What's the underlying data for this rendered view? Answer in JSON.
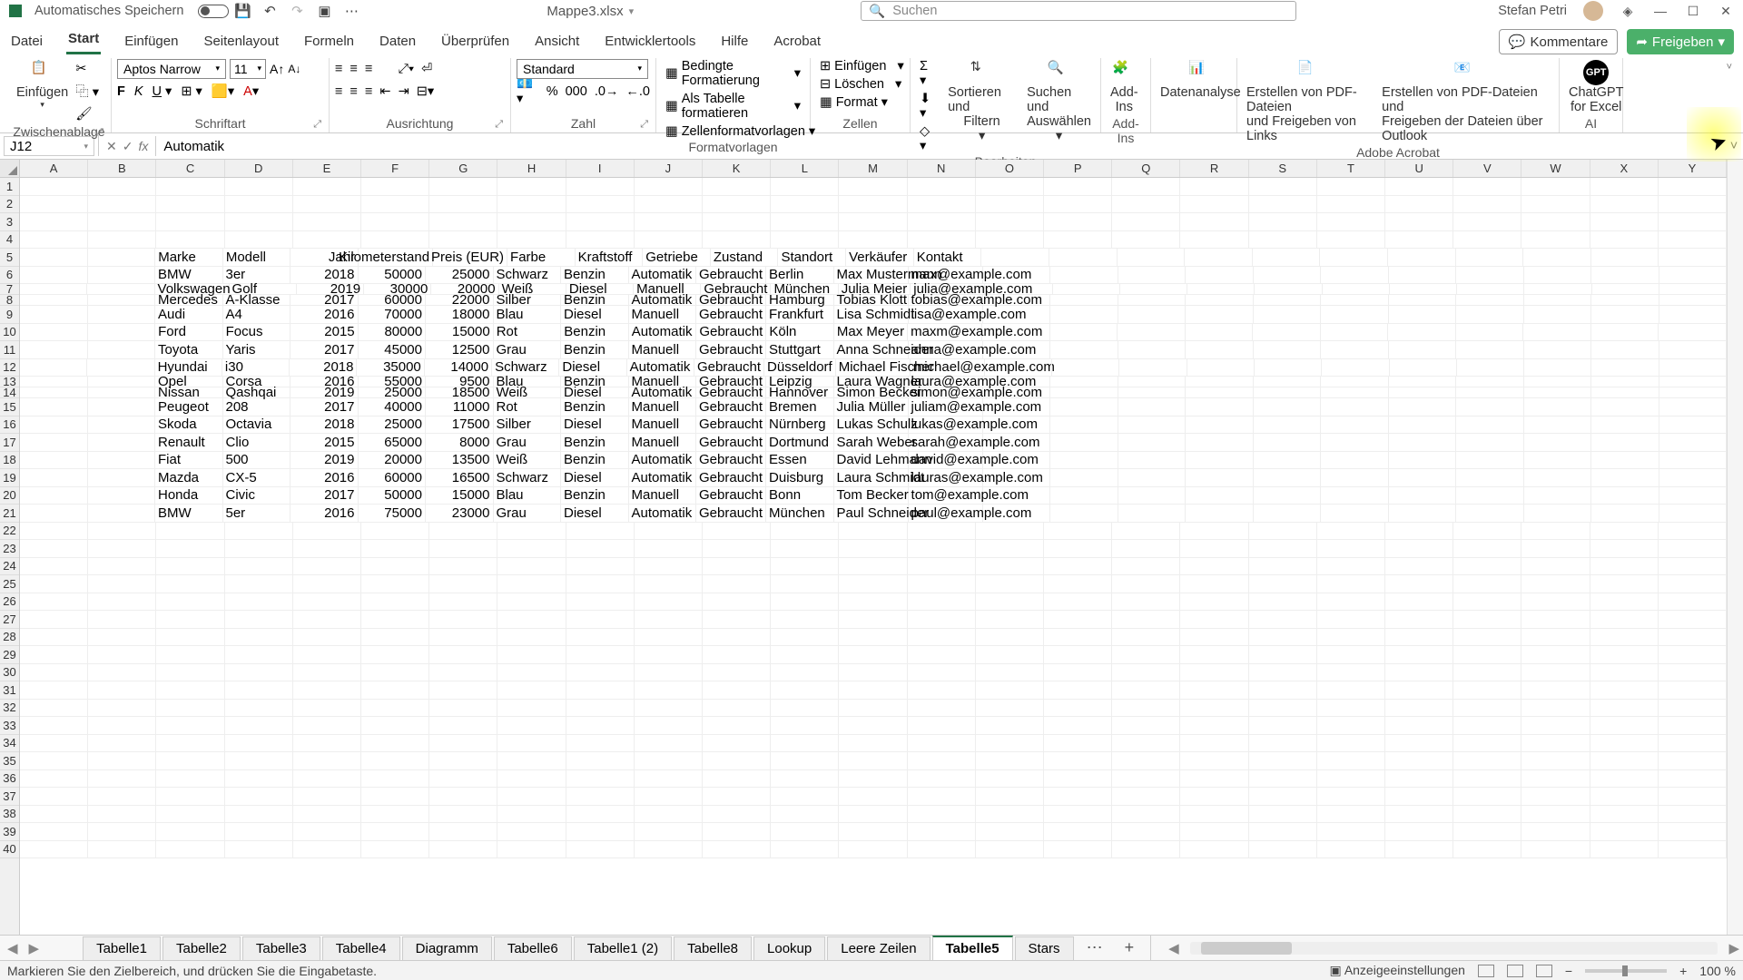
{
  "titlebar": {
    "autosave_label": "Automatisches Speichern",
    "filename": "Mappe3.xlsx",
    "search_placeholder": "Suchen",
    "username": "Stefan Petri"
  },
  "menutabs": [
    "Datei",
    "Start",
    "Einfügen",
    "Seitenlayout",
    "Formeln",
    "Daten",
    "Überprüfen",
    "Ansicht",
    "Entwicklertools",
    "Hilfe",
    "Acrobat"
  ],
  "active_tab": 1,
  "menu_right": {
    "comments": "Kommentare",
    "share": "Freigeben"
  },
  "ribbon": {
    "clipboard": {
      "label": "Zwischenablage",
      "paste": "Einfügen"
    },
    "font": {
      "label": "Schriftart",
      "name": "Aptos Narrow",
      "size": "11",
      "bold": "F",
      "italic": "K",
      "underline": "U"
    },
    "align": {
      "label": "Ausrichtung"
    },
    "number": {
      "label": "Zahl",
      "format": "Standard"
    },
    "styles": {
      "label": "Formatvorlagen",
      "cond": "Bedingte Formatierung",
      "table": "Als Tabelle formatieren",
      "cellstyles": "Zellenformatvorlagen"
    },
    "cells": {
      "label": "Zellen",
      "insert": "Einfügen",
      "delete": "Löschen",
      "format": "Format"
    },
    "editing": {
      "label": "Bearbeiten",
      "sort": "Sortieren und",
      "sort2": "Filtern",
      "find": "Suchen und",
      "find2": "Auswählen"
    },
    "addins": {
      "label": "Add-Ins",
      "addins": "Add-",
      "addins2": "Ins"
    },
    "analysis": {
      "label": "",
      "btn": "Datenanalyse"
    },
    "acrobat": {
      "label": "Adobe Acrobat",
      "pdf1a": "Erstellen von PDF-Dateien",
      "pdf1b": "und Freigeben von Links",
      "pdf2a": "Erstellen von PDF-Dateien und",
      "pdf2b": "Freigeben der Dateien über Outlook"
    },
    "ai": {
      "label": "AI",
      "gpt1": "ChatGPT",
      "gpt2": "for Excel"
    }
  },
  "formulabar": {
    "namebox": "J12",
    "formula": "Automatik"
  },
  "columns_visible": [
    "A",
    "B",
    "C",
    "D",
    "E",
    "F",
    "G",
    "H",
    "I",
    "J",
    "K",
    "L",
    "M",
    "N",
    "O",
    "P",
    "Q",
    "R",
    "S",
    "T",
    "U",
    "V",
    "W",
    "X",
    "Y"
  ],
  "rows_visible": [
    1,
    2,
    3,
    4,
    5,
    6,
    7,
    8,
    9,
    10,
    11,
    12,
    13,
    14,
    15,
    16,
    17,
    18,
    19,
    20,
    21,
    22,
    23,
    24,
    25,
    26,
    27,
    28,
    29,
    30,
    31,
    32,
    33,
    34,
    35,
    36,
    37,
    38,
    39,
    40
  ],
  "short_rows": [
    7,
    8,
    13,
    14
  ],
  "headers": {
    "row": 5,
    "cells": {
      "C": "Marke",
      "D": "Modell",
      "E": "Jahr",
      "F": "Kilometerstand",
      "G": "Preis (EUR)",
      "H": "Farbe",
      "I": "Kraftstoff",
      "J": "Getriebe",
      "K": "Zustand",
      "L": "Standort",
      "M": "Verkäufer",
      "N": "Kontakt"
    }
  },
  "data_rows": [
    {
      "row": 6,
      "C": "BMW",
      "D": "3er",
      "E": "2018",
      "F": "50000",
      "G": "25000",
      "H": "Schwarz",
      "I": "Benzin",
      "J": "Automatik",
      "K": "Gebraucht",
      "L": "Berlin",
      "M": "Max Mustermann",
      "N": "max@example.com"
    },
    {
      "row": 7,
      "C": "Volkswagen",
      "D": "Golf",
      "E": "2019",
      "F": "30000",
      "G": "20000",
      "H": "Weiß",
      "I": "Diesel",
      "J": "Manuell",
      "K": "Gebraucht",
      "L": "München",
      "M": "Julia Meier",
      "N": "julia@example.com"
    },
    {
      "row": 8,
      "C": "Mercedes",
      "D": "A-Klasse",
      "E": "2017",
      "F": "60000",
      "G": "22000",
      "H": "Silber",
      "I": "Benzin",
      "J": "Automatik",
      "K": "Gebraucht",
      "L": "Hamburg",
      "M": "Tobias Klott",
      "N": "tobias@example.com"
    },
    {
      "row": 9,
      "C": "Audi",
      "D": "A4",
      "E": "2016",
      "F": "70000",
      "G": "18000",
      "H": "Blau",
      "I": "Diesel",
      "J": "Manuell",
      "K": "Gebraucht",
      "L": "Frankfurt",
      "M": "Lisa Schmidt",
      "N": "lisa@example.com"
    },
    {
      "row": 10,
      "C": "Ford",
      "D": "Focus",
      "E": "2015",
      "F": "80000",
      "G": "15000",
      "H": "Rot",
      "I": "Benzin",
      "J": "Automatik",
      "K": "Gebraucht",
      "L": "Köln",
      "M": "Max Meyer",
      "N": "maxm@example.com"
    },
    {
      "row": 11,
      "C": "Toyota",
      "D": "Yaris",
      "E": "2017",
      "F": "45000",
      "G": "12500",
      "H": "Grau",
      "I": "Benzin",
      "J": "Manuell",
      "K": "Gebraucht",
      "L": "Stuttgart",
      "M": "Anna Schneider",
      "N": "anna@example.com"
    },
    {
      "row": 12,
      "C": "Hyundai",
      "D": "i30",
      "E": "2018",
      "F": "35000",
      "G": "14000",
      "H": "Schwarz",
      "I": "Diesel",
      "J": "Automatik",
      "K": "Gebraucht",
      "L": "Düsseldorf",
      "M": "Michael Fischer",
      "N": "michael@example.com"
    },
    {
      "row": 13,
      "C": "Opel",
      "D": "Corsa",
      "E": "2016",
      "F": "55000",
      "G": "9500",
      "H": "Blau",
      "I": "Benzin",
      "J": "Manuell",
      "K": "Gebraucht",
      "L": "Leipzig",
      "M": "Laura Wagner",
      "N": "laura@example.com"
    },
    {
      "row": 14,
      "C": "Nissan",
      "D": "Qashqai",
      "E": "2019",
      "F": "25000",
      "G": "18500",
      "H": "Weiß",
      "I": "Diesel",
      "J": "Automatik",
      "K": "Gebraucht",
      "L": "Hannover",
      "M": "Simon Becker",
      "N": "simon@example.com"
    },
    {
      "row": 15,
      "C": "Peugeot",
      "D": "208",
      "E": "2017",
      "F": "40000",
      "G": "11000",
      "H": "Rot",
      "I": "Benzin",
      "J": "Manuell",
      "K": "Gebraucht",
      "L": "Bremen",
      "M": "Julia Müller",
      "N": "juliam@example.com"
    },
    {
      "row": 16,
      "C": "Skoda",
      "D": "Octavia",
      "E": "2018",
      "F": "25000",
      "G": "17500",
      "H": "Silber",
      "I": "Diesel",
      "J": "Manuell",
      "K": "Gebraucht",
      "L": "Nürnberg",
      "M": "Lukas Schulz",
      "N": "lukas@example.com"
    },
    {
      "row": 17,
      "C": "Renault",
      "D": "Clio",
      "E": "2015",
      "F": "65000",
      "G": "8000",
      "H": "Grau",
      "I": "Benzin",
      "J": "Manuell",
      "K": "Gebraucht",
      "L": "Dortmund",
      "M": "Sarah Weber",
      "N": "sarah@example.com"
    },
    {
      "row": 18,
      "C": "Fiat",
      "D": "500",
      "E": "2019",
      "F": "20000",
      "G": "13500",
      "H": "Weiß",
      "I": "Benzin",
      "J": "Automatik",
      "K": "Gebraucht",
      "L": "Essen",
      "M": "David Lehmann",
      "N": "david@example.com"
    },
    {
      "row": 19,
      "C": "Mazda",
      "D": "CX-5",
      "E": "2016",
      "F": "60000",
      "G": "16500",
      "H": "Schwarz",
      "I": "Diesel",
      "J": "Automatik",
      "K": "Gebraucht",
      "L": "Duisburg",
      "M": "Laura Schmidt",
      "N": "lauras@example.com"
    },
    {
      "row": 20,
      "C": "Honda",
      "D": "Civic",
      "E": "2017",
      "F": "50000",
      "G": "15000",
      "H": "Blau",
      "I": "Benzin",
      "J": "Manuell",
      "K": "Gebraucht",
      "L": "Bonn",
      "M": "Tom Becker",
      "N": "tom@example.com"
    },
    {
      "row": 21,
      "C": "BMW",
      "D": "5er",
      "E": "2016",
      "F": "75000",
      "G": "23000",
      "H": "Grau",
      "I": "Diesel",
      "J": "Automatik",
      "K": "Gebraucht",
      "L": "München",
      "M": "Paul Schneider",
      "N": "paul@example.com"
    }
  ],
  "sheets": [
    "Tabelle1",
    "Tabelle2",
    "Tabelle3",
    "Tabelle4",
    "Diagramm",
    "Tabelle6",
    "Tabelle1 (2)",
    "Tabelle8",
    "Lookup",
    "Leere Zeilen",
    "Tabelle5",
    "Stars"
  ],
  "active_sheet": 10,
  "statusbar": {
    "msg": "Markieren Sie den Zielbereich, und drücken Sie die Eingabetaste.",
    "display_settings": "Anzeigeeinstellungen",
    "zoom": "100 %"
  }
}
